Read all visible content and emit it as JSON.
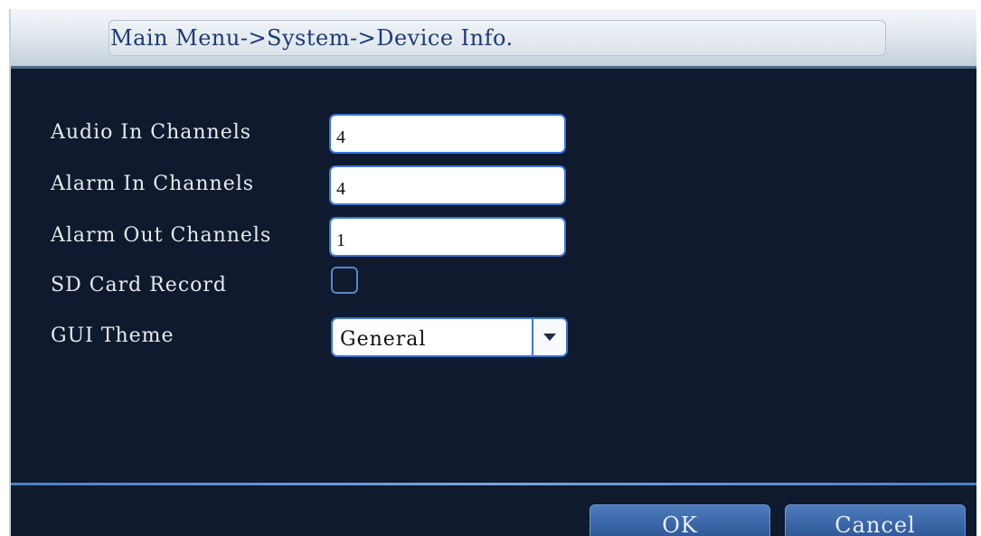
{
  "header": {
    "breadcrumb": "Main Menu->System->Device Info."
  },
  "form": {
    "audio_in": {
      "label": "Audio In Channels",
      "value": "4"
    },
    "alarm_in": {
      "label": "Alarm In Channels",
      "value": "4"
    },
    "alarm_out": {
      "label": "Alarm Out Channels",
      "value": "1"
    },
    "sd_card": {
      "label": "SD Card Record",
      "checked": false
    },
    "gui_theme": {
      "label": "GUI Theme",
      "value": "General"
    }
  },
  "footer": {
    "ok_label": "OK",
    "cancel_label": "Cancel"
  },
  "colors": {
    "background": "#0f1a2e",
    "accent": "#3c77d8",
    "button": "#3a66a7"
  },
  "icons": {
    "dropdown": "triangle-down-icon"
  }
}
